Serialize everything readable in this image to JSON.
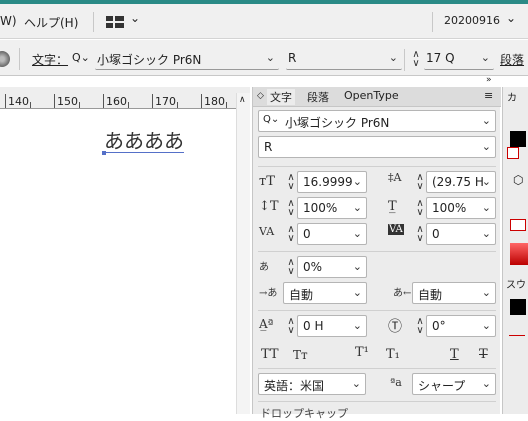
{
  "menu": {
    "cut": "W)",
    "help": "ヘルプ(H)",
    "layout_chev": "⌄",
    "date": "20200916",
    "date_chev": "⌄"
  },
  "control": {
    "label": "文字：",
    "font_search": "Q⌄",
    "font": "小塚ゴシック Pr6N",
    "style": "R",
    "size": "17 Q",
    "size_chev": "⌄",
    "para": "段落"
  },
  "ruler": {
    "labels": [
      "140",
      "150",
      "160",
      "170",
      "180"
    ]
  },
  "canvas": {
    "text": "ああああ"
  },
  "panel": {
    "tabs": [
      "文字",
      "段落",
      "OpenType"
    ],
    "font": "小塚ゴシック Pr6N",
    "style": "R",
    "size": "16.9999",
    "leading": "(29.75 H",
    "vscale": "100%",
    "hscale": "100%",
    "tracking_kern": "0",
    "tracking": "0",
    "tsume": "0%",
    "aki_left": "自動",
    "aki_right": "自動",
    "baseline": "0 H",
    "rotate": "0°",
    "lang": "英語：米国",
    "aa": "シャープ",
    "cut_bottom": "ドロップキャップ"
  },
  "rightpanel": {
    "top": "カ",
    "bottom": "スウ"
  }
}
